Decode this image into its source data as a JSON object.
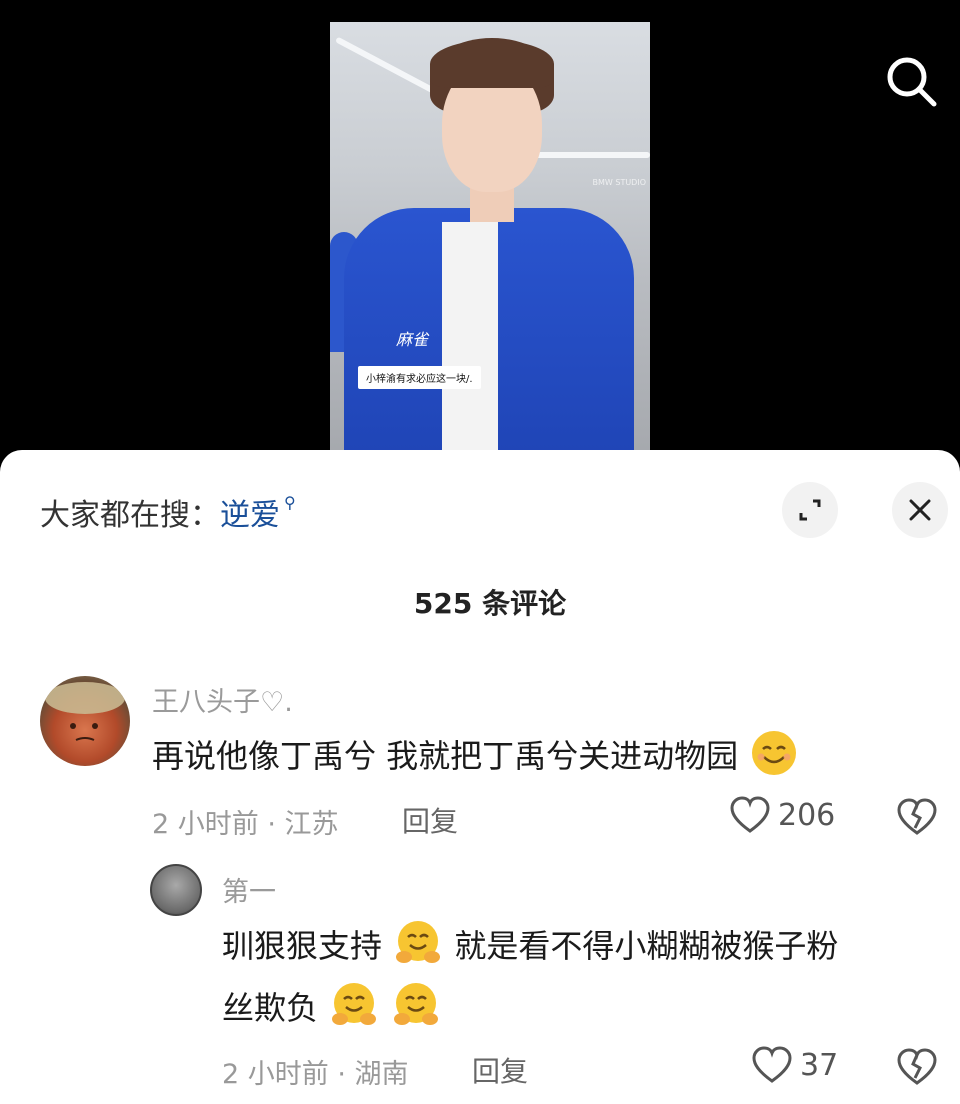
{
  "video": {
    "signature": "麻雀",
    "caption": "小梓渝有求必应这一块/.",
    "store_sign": "BMW STUDIO",
    "search_icon": "search-icon"
  },
  "trending": {
    "label": "大家都在搜：",
    "keyword": "逆爱",
    "icon": "magnifier-small-icon"
  },
  "comments_header": {
    "count_label": "525 条评论"
  },
  "comments": [
    {
      "username": "王八头子♡.",
      "text": "再说他像丁禹兮  我就把丁禹兮关进动物园",
      "emoji": "smile-emoji",
      "time": "2 小时前 · 江苏",
      "reply_label": "回复",
      "likes": "206"
    },
    {
      "username": "第一",
      "text_line1": "玔狠狠支持",
      "text_line1b": "就是看不得小糊糊被猴子粉",
      "text_line2": "丝欺负",
      "emoji": "hug-emoji",
      "time": "2 小时前 · 湖南",
      "reply_label": "回复",
      "likes": "37"
    }
  ],
  "colors": {
    "keyword": "#1a4f99",
    "meta": "#999999",
    "sheet": "#ffffff"
  }
}
